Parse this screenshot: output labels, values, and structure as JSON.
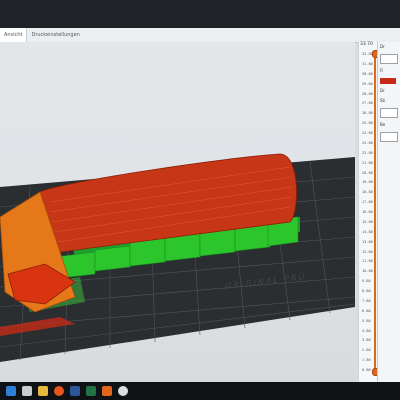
{
  "tabs": [
    "Ansicht",
    "Druckeinstellungen"
  ],
  "slider": {
    "top_value": "33.70",
    "ticks": [
      "32.80",
      "31.80",
      "30.80",
      "29.80",
      "28.80",
      "27.80",
      "26.80",
      "25.80",
      "24.80",
      "23.80",
      "22.80",
      "21.80",
      "20.80",
      "19.80",
      "18.80",
      "17.80",
      "16.80",
      "15.80",
      "14.80",
      "13.80",
      "12.80",
      "11.80",
      "10.80",
      "9.80",
      "8.80",
      "7.80",
      "6.80",
      "5.80",
      "4.80",
      "3.80",
      "2.80",
      "1.80",
      "0.80"
    ]
  },
  "bed_label": "ORIGINAL PRU",
  "side_panel": {
    "rows": [
      "Dr",
      "",
      "Fi",
      "",
      "Dr",
      "Sti",
      "Be"
    ]
  },
  "colors": {
    "perimeter": "#c42a16",
    "support": "#2cc52c",
    "infill": "#e5791a",
    "bed": "#2c2f33",
    "slider": "#e0651d"
  },
  "taskbar_icons": [
    "windows-icon",
    "search-icon",
    "folder-icon",
    "firefox-icon",
    "word-icon",
    "excel-icon",
    "prusa-icon",
    "chrome-icon"
  ]
}
